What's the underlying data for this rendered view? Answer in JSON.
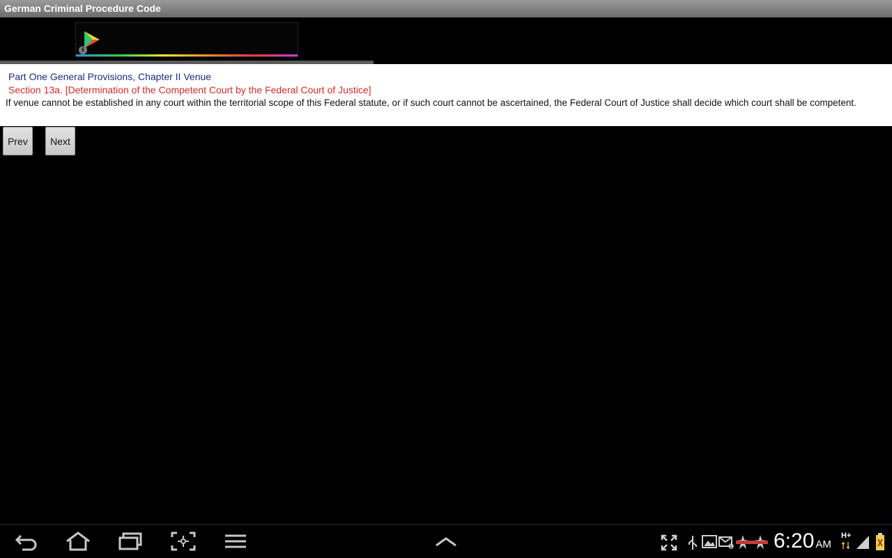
{
  "app": {
    "title": "German Criminal Procedure Code"
  },
  "ad": {
    "info_symbol": "i"
  },
  "content": {
    "breadcrumb": "Part One General Provisions, Chapter II Venue",
    "section_title": "Section 13a. [Determination of the Competent Court by the Federal Court of Justice]",
    "body": "If venue cannot be established in any court within the territorial scope of this Federal statute, or if such court cannot be ascertained, the Federal Court of Justice shall decide which court shall be competent."
  },
  "buttons": {
    "prev_label": "Prev",
    "next_label": "Next"
  },
  "status": {
    "time": "6:20",
    "ampm": "AM",
    "network": "H+"
  },
  "icons": {
    "back": "back-icon",
    "home": "home-icon",
    "recent": "recent-apps-icon",
    "screenshot": "screenshot-icon",
    "menu": "menu-icon",
    "up": "chevron-up-icon",
    "expand": "expand-icon",
    "usb": "usb-icon",
    "gallery": "gallery-icon",
    "email": "email-icon",
    "game": "game-icon",
    "signal": "signal-icon",
    "battery": "battery-icon"
  },
  "colors": {
    "breadcrumb": "#1e2a7a",
    "section": "#d12b2b",
    "background": "#000000",
    "content_bg": "#ffffff"
  }
}
